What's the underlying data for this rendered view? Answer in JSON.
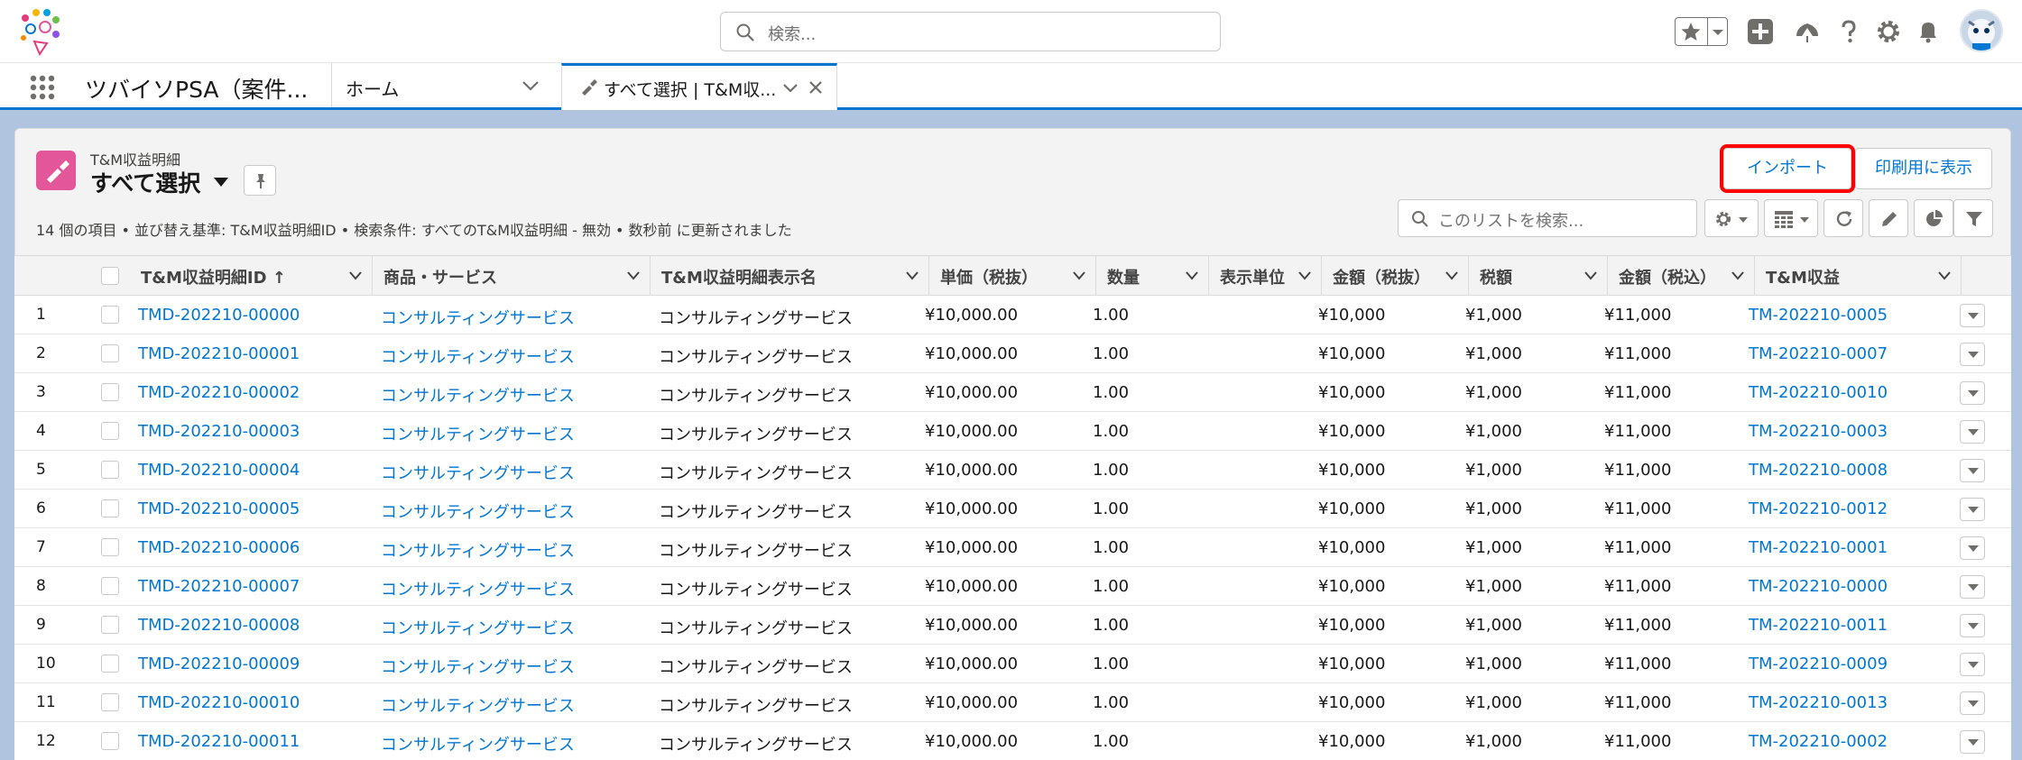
{
  "header": {
    "search_placeholder": "検索..."
  },
  "nav": {
    "app_name": "ツバイソPSA（案件...",
    "home_label": "ホーム",
    "active_tab_label": "すべて選択 | T&M収..."
  },
  "list": {
    "object_label": "T&M収益明細",
    "view_title": "すべて選択",
    "meta": "14 個の項目 • 並び替え基準: T&M収益明細ID • 検索条件: すべてのT&M収益明細 - 無効 • 数秒前 に更新されました",
    "import_label": "インポート",
    "print_label": "印刷用に表示",
    "search_placeholder": "このリストを検索..."
  },
  "columns": [
    {
      "label": "T&M収益明細ID",
      "sorted": "asc"
    },
    {
      "label": "商品・サービス"
    },
    {
      "label": "T&M収益明細表示名"
    },
    {
      "label": "単価（税抜）"
    },
    {
      "label": "数量"
    },
    {
      "label": "表示単位"
    },
    {
      "label": "金額（税抜）"
    },
    {
      "label": "税額"
    },
    {
      "label": "金額（税込）"
    },
    {
      "label": "T&M収益"
    }
  ],
  "sort_indicator": "↑",
  "rows": [
    {
      "n": "1",
      "id": "TMD-202210-00000",
      "product": "コンサルティングサービス",
      "name": "コンサルティングサービス",
      "price": "¥10,000.00",
      "qty": "1.00",
      "unit": "",
      "amount": "¥10,000",
      "tax": "¥1,000",
      "total": "¥11,000",
      "tm": "TM-202210-0005"
    },
    {
      "n": "2",
      "id": "TMD-202210-00001",
      "product": "コンサルティングサービス",
      "name": "コンサルティングサービス",
      "price": "¥10,000.00",
      "qty": "1.00",
      "unit": "",
      "amount": "¥10,000",
      "tax": "¥1,000",
      "total": "¥11,000",
      "tm": "TM-202210-0007"
    },
    {
      "n": "3",
      "id": "TMD-202210-00002",
      "product": "コンサルティングサービス",
      "name": "コンサルティングサービス",
      "price": "¥10,000.00",
      "qty": "1.00",
      "unit": "",
      "amount": "¥10,000",
      "tax": "¥1,000",
      "total": "¥11,000",
      "tm": "TM-202210-0010"
    },
    {
      "n": "4",
      "id": "TMD-202210-00003",
      "product": "コンサルティングサービス",
      "name": "コンサルティングサービス",
      "price": "¥10,000.00",
      "qty": "1.00",
      "unit": "",
      "amount": "¥10,000",
      "tax": "¥1,000",
      "total": "¥11,000",
      "tm": "TM-202210-0003"
    },
    {
      "n": "5",
      "id": "TMD-202210-00004",
      "product": "コンサルティングサービス",
      "name": "コンサルティングサービス",
      "price": "¥10,000.00",
      "qty": "1.00",
      "unit": "",
      "amount": "¥10,000",
      "tax": "¥1,000",
      "total": "¥11,000",
      "tm": "TM-202210-0008"
    },
    {
      "n": "6",
      "id": "TMD-202210-00005",
      "product": "コンサルティングサービス",
      "name": "コンサルティングサービス",
      "price": "¥10,000.00",
      "qty": "1.00",
      "unit": "",
      "amount": "¥10,000",
      "tax": "¥1,000",
      "total": "¥11,000",
      "tm": "TM-202210-0012"
    },
    {
      "n": "7",
      "id": "TMD-202210-00006",
      "product": "コンサルティングサービス",
      "name": "コンサルティングサービス",
      "price": "¥10,000.00",
      "qty": "1.00",
      "unit": "",
      "amount": "¥10,000",
      "tax": "¥1,000",
      "total": "¥11,000",
      "tm": "TM-202210-0001"
    },
    {
      "n": "8",
      "id": "TMD-202210-00007",
      "product": "コンサルティングサービス",
      "name": "コンサルティングサービス",
      "price": "¥10,000.00",
      "qty": "1.00",
      "unit": "",
      "amount": "¥10,000",
      "tax": "¥1,000",
      "total": "¥11,000",
      "tm": "TM-202210-0000"
    },
    {
      "n": "9",
      "id": "TMD-202210-00008",
      "product": "コンサルティングサービス",
      "name": "コンサルティングサービス",
      "price": "¥10,000.00",
      "qty": "1.00",
      "unit": "",
      "amount": "¥10,000",
      "tax": "¥1,000",
      "total": "¥11,000",
      "tm": "TM-202210-0011"
    },
    {
      "n": "10",
      "id": "TMD-202210-00009",
      "product": "コンサルティングサービス",
      "name": "コンサルティングサービス",
      "price": "¥10,000.00",
      "qty": "1.00",
      "unit": "",
      "amount": "¥10,000",
      "tax": "¥1,000",
      "total": "¥11,000",
      "tm": "TM-202210-0009"
    },
    {
      "n": "11",
      "id": "TMD-202210-00010",
      "product": "コンサルティングサービス",
      "name": "コンサルティングサービス",
      "price": "¥10,000.00",
      "qty": "1.00",
      "unit": "",
      "amount": "¥10,000",
      "tax": "¥1,000",
      "total": "¥11,000",
      "tm": "TM-202210-0013"
    },
    {
      "n": "12",
      "id": "TMD-202210-00011",
      "product": "コンサルティングサービス",
      "name": "コンサルティングサービス",
      "price": "¥10,000.00",
      "qty": "1.00",
      "unit": "",
      "amount": "¥10,000",
      "tax": "¥1,000",
      "total": "¥11,000",
      "tm": "TM-202210-0002"
    }
  ],
  "colors": {
    "brand_blue": "#0176d3",
    "object_icon": "#e3569a",
    "highlight": "#ff0000"
  }
}
